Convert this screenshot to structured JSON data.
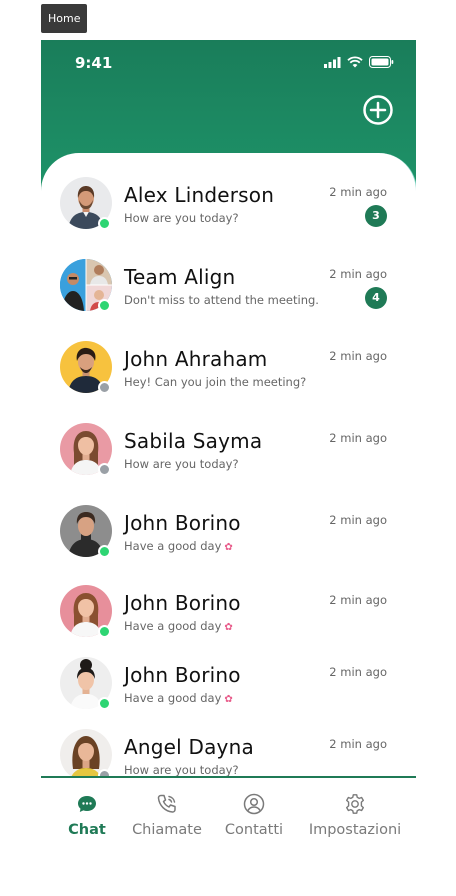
{
  "frame_label": "Home",
  "status": {
    "time": "9:41"
  },
  "colors": {
    "accent": "#1f7a56",
    "online": "#2ed573",
    "offline": "#9aa0a6"
  },
  "icons": {
    "add": "plus-circle-icon"
  },
  "chats": [
    {
      "name": "Alex Linderson",
      "preview": "How are you today?",
      "time": "2 min ago",
      "unread": "3",
      "online": true
    },
    {
      "name": "Team Align",
      "preview": "Don't miss to attend the meeting.",
      "time": "2 min ago",
      "unread": "4",
      "online": true
    },
    {
      "name": "John Ahraham",
      "preview": "Hey! Can you join the meeting?",
      "time": "2 min ago",
      "online": false
    },
    {
      "name": "Sabila Sayma",
      "preview": "How are you today?",
      "time": "2 min ago",
      "online": false
    },
    {
      "name": "John Borino",
      "preview": "Have a good day",
      "time": "2 min ago",
      "online": true
    },
    {
      "name": "John Borino",
      "preview": "Have a good day",
      "time": "2 min ago",
      "online": true
    },
    {
      "name": "John Borino",
      "preview": "Have a good day",
      "time": "2 min ago",
      "online": true
    },
    {
      "name": "Angel Dayna",
      "preview": "How are you today?",
      "time": "2 min ago",
      "online": false
    }
  ],
  "tabs": [
    {
      "label": "Chat",
      "icon": "chat-bubble-icon",
      "active": true
    },
    {
      "label": "Chiamate",
      "icon": "phone-icon",
      "active": false
    },
    {
      "label": "Contatti",
      "icon": "user-circle-icon",
      "active": false
    },
    {
      "label": "Impostazioni",
      "icon": "gear-icon",
      "active": false
    }
  ]
}
